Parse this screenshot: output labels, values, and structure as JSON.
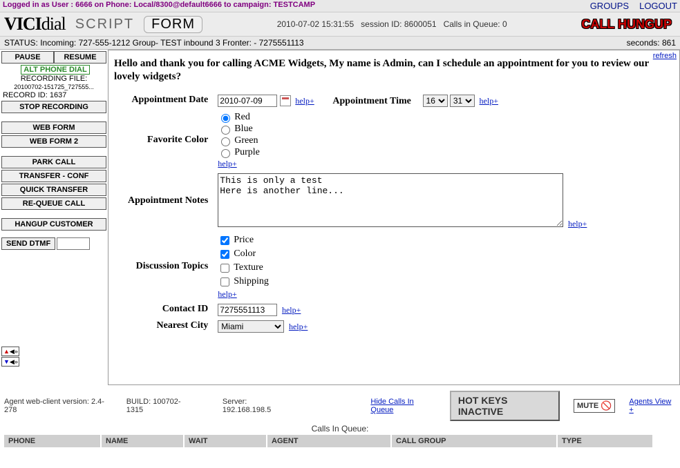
{
  "top": {
    "login_text": "Logged in as User : 6666 on Phone: Local/8300@default6666 to campaign: TESTCAMP",
    "groups": "GROUPS",
    "logout": "LOGOUT"
  },
  "head": {
    "logo_bold": "VICI",
    "logo_thin": "dial",
    "tab_script": "SCRIPT",
    "tab_form": "FORM",
    "datetime": "2010-07-02 15:31:55",
    "session_lbl": "session ID:",
    "session_id": "8600051",
    "queue_lbl": "Calls in Queue:",
    "queue_n": "0",
    "call_status": "CALL HUNGUP"
  },
  "status": {
    "left": "STATUS: Incoming: 727-555-1212 Group- TEST inbound 3   Fronter: - 7275551113",
    "seconds_lbl": "seconds:",
    "seconds": "861"
  },
  "sidebar": {
    "pause": "PAUSE",
    "resume": "RESUME",
    "alt_phone": "ALT PHONE DIAL",
    "rec_file_lbl": "RECORDING FILE:",
    "rec_file": "20100702-151725_727555...",
    "rec_id_lbl": "RECORD ID:",
    "rec_id": "1637",
    "stop_rec": "STOP RECORDING",
    "web_form": "WEB FORM",
    "web_form2": "WEB FORM 2",
    "park": "PARK CALL",
    "transfer": "TRANSFER - CONF",
    "quick": "QUICK  TRANSFER",
    "requeue": "RE-QUEUE CALL",
    "hangup": "HANGUP CUSTOMER",
    "dtmf": "SEND DTMF"
  },
  "content": {
    "refresh": "refresh",
    "script": "Hello and thank you for calling ACME Widgets, My name is Admin, can I schedule an appointment for you to review our lovely widgets?",
    "help": "help+",
    "labels": {
      "appt_date": "Appointment Date",
      "appt_time": "Appointment Time",
      "fav_color": "Favorite Color",
      "notes": "Appointment Notes",
      "topics": "Discussion Topics",
      "contact_id": "Contact ID",
      "city": "Nearest City"
    },
    "appt_date": "2010-07-09",
    "appt_hour": "16",
    "appt_min": "31",
    "colors": {
      "red": "Red",
      "blue": "Blue",
      "green": "Green",
      "purple": "Purple"
    },
    "notes": "This is only a test\nHere is another line...",
    "topics": {
      "price": "Price",
      "color": "Color",
      "texture": "Texture",
      "shipping": "Shipping"
    },
    "contact_id": "7275551113",
    "city": "Miami"
  },
  "bottom": {
    "version": "Agent web-client version: 2.4-278",
    "build": "BUILD: 100702-1315",
    "server": "Server: 192.168.198.5",
    "hide_queue": "Hide Calls In Queue",
    "hotkeys": "HOT KEYS INACTIVE",
    "mute": "MUTE",
    "agents_view": "Agents View +",
    "queue_hdr": "Calls In Queue:",
    "cols": {
      "phone": "PHONE",
      "name": "NAME",
      "wait": "WAIT",
      "agent": "AGENT",
      "group": "CALL GROUP",
      "type": "TYPE"
    }
  }
}
